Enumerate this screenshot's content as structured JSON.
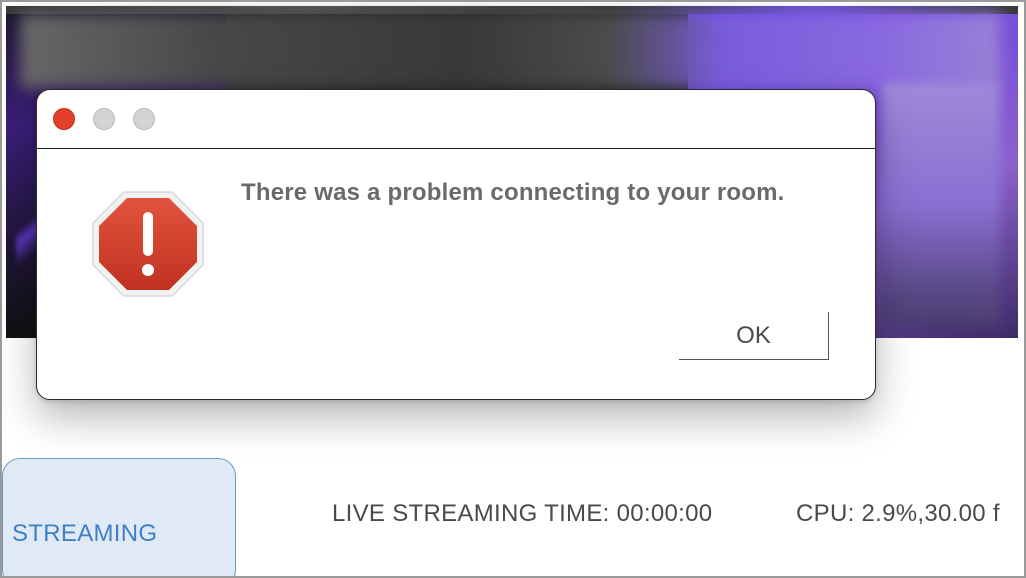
{
  "dialog": {
    "message": "There was a problem connecting to your room.",
    "ok_label": "OK",
    "icon": "alert-octagon-icon",
    "window_controls": [
      "close",
      "minimize",
      "zoom"
    ]
  },
  "status_bar": {
    "streaming_button_label": "STREAMING",
    "live_time": "LIVE STREAMING TIME: 00:00:00",
    "cpu": "CPU: 2.9%,30.00 f"
  },
  "colors": {
    "alert_red": "#d03c2a",
    "close_button": "#e0402b",
    "streaming_accent": "#3f7fc4",
    "streaming_bg": "#e0eaf6",
    "preview_purple": "#7b52d6"
  }
}
